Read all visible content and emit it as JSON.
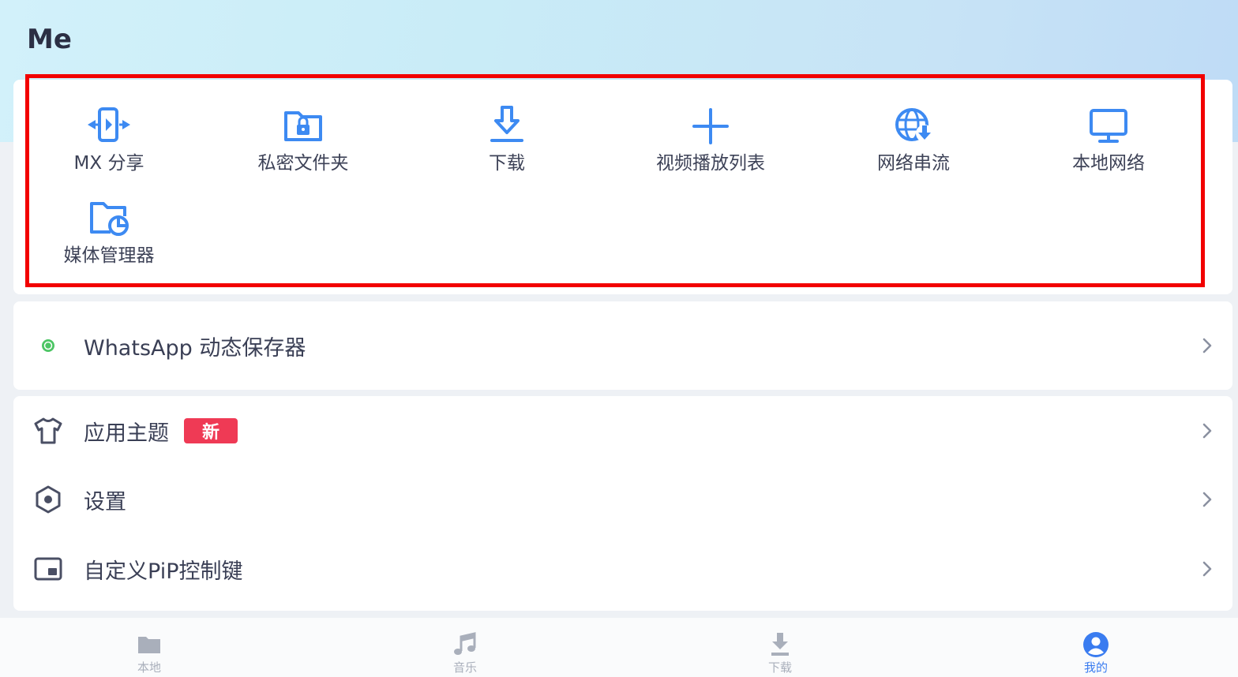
{
  "header": {
    "title": "Me"
  },
  "tools": [
    {
      "label": "MX 分享",
      "icon": "mx-share-icon"
    },
    {
      "label": "私密文件夹",
      "icon": "private-folder-icon"
    },
    {
      "label": "下载",
      "icon": "download-icon"
    },
    {
      "label": "视频播放列表",
      "icon": "plus-icon"
    },
    {
      "label": "网络串流",
      "icon": "network-stream-icon"
    },
    {
      "label": "本地网络",
      "icon": "monitor-icon"
    },
    {
      "label": "媒体管理器",
      "icon": "media-manager-icon"
    }
  ],
  "whatsapp": {
    "label": "WhatsApp 动态保存器",
    "icon": "whatsapp-icon"
  },
  "settings_list": [
    {
      "label": "应用主题",
      "badge": "新",
      "icon": "shirt-icon"
    },
    {
      "label": "设置",
      "icon": "settings-hexagon-icon"
    },
    {
      "label": "自定义PiP控制键",
      "icon": "pip-icon"
    }
  ],
  "bottom_nav": [
    {
      "label": "本地",
      "icon": "folder-icon"
    },
    {
      "label": "音乐",
      "icon": "music-icon"
    },
    {
      "label": "下载",
      "icon": "download-icon"
    },
    {
      "label": "我的",
      "icon": "user-icon",
      "active": true
    }
  ],
  "colors": {
    "accent": "#3a7cf0",
    "icon_blue": "#3d8af2",
    "badge_red": "#ef3a55",
    "highlight_red": "#f20000",
    "whatsapp_green": "#4cc564"
  }
}
